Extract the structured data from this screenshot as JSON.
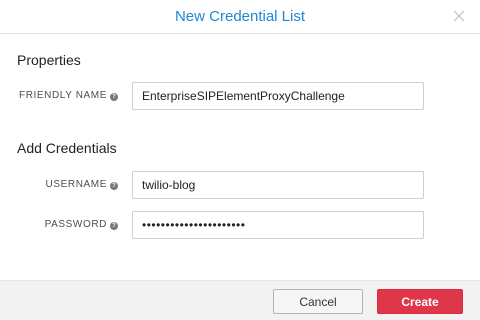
{
  "dialog": {
    "title": "New Credential List",
    "close_icon": "close-icon"
  },
  "properties": {
    "heading": "Properties",
    "friendly_name": {
      "label": "FRIENDLY NAME",
      "help_icon": "question-circle-icon",
      "value": "EnterpriseSIPElementProxyChallenge"
    }
  },
  "credentials": {
    "heading": "Add Credentials",
    "username": {
      "label": "USERNAME",
      "help_icon": "question-circle-icon",
      "value": "twilio-blog"
    },
    "password": {
      "label": "PASSWORD",
      "help_icon": "question-circle-icon",
      "value": "••••••••••••••••••••••"
    }
  },
  "footer": {
    "cancel_label": "Cancel",
    "create_label": "Create"
  },
  "colors": {
    "title": "#1e88d6",
    "create_button": "#e0364a",
    "footer_bg": "#f2f2f2"
  }
}
